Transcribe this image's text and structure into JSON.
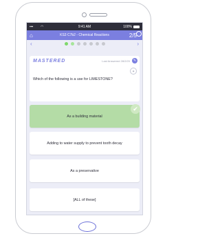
{
  "statusbar": {
    "time": "9:41 AM",
    "battery": "100%"
  },
  "titlebar": {
    "home_icon": "home-icon",
    "title": "KS3 C7b2 - Chemical Reactions",
    "progress": "2/5"
  },
  "nav": {
    "prev_icon": "chevron-left-icon",
    "next_icon": "chevron-right-icon",
    "dots": 7,
    "active_dots": 2
  },
  "question": {
    "status": "MASTERED",
    "last_answered": "Last Answered 28/2/20",
    "text": "Which of the following is a use for LIMESTONE?"
  },
  "answers": [
    {
      "text": "As a building material",
      "correct": true
    },
    {
      "text": "Adding to water supply to prevent tooth decay",
      "correct": false
    },
    {
      "text": "As a preservative",
      "correct": false
    },
    {
      "text": "[ALL of these]",
      "correct": false
    }
  ],
  "colors": {
    "accent": "#7b7fe0",
    "correct": "#b4dca6",
    "background": "#ecedf7"
  }
}
